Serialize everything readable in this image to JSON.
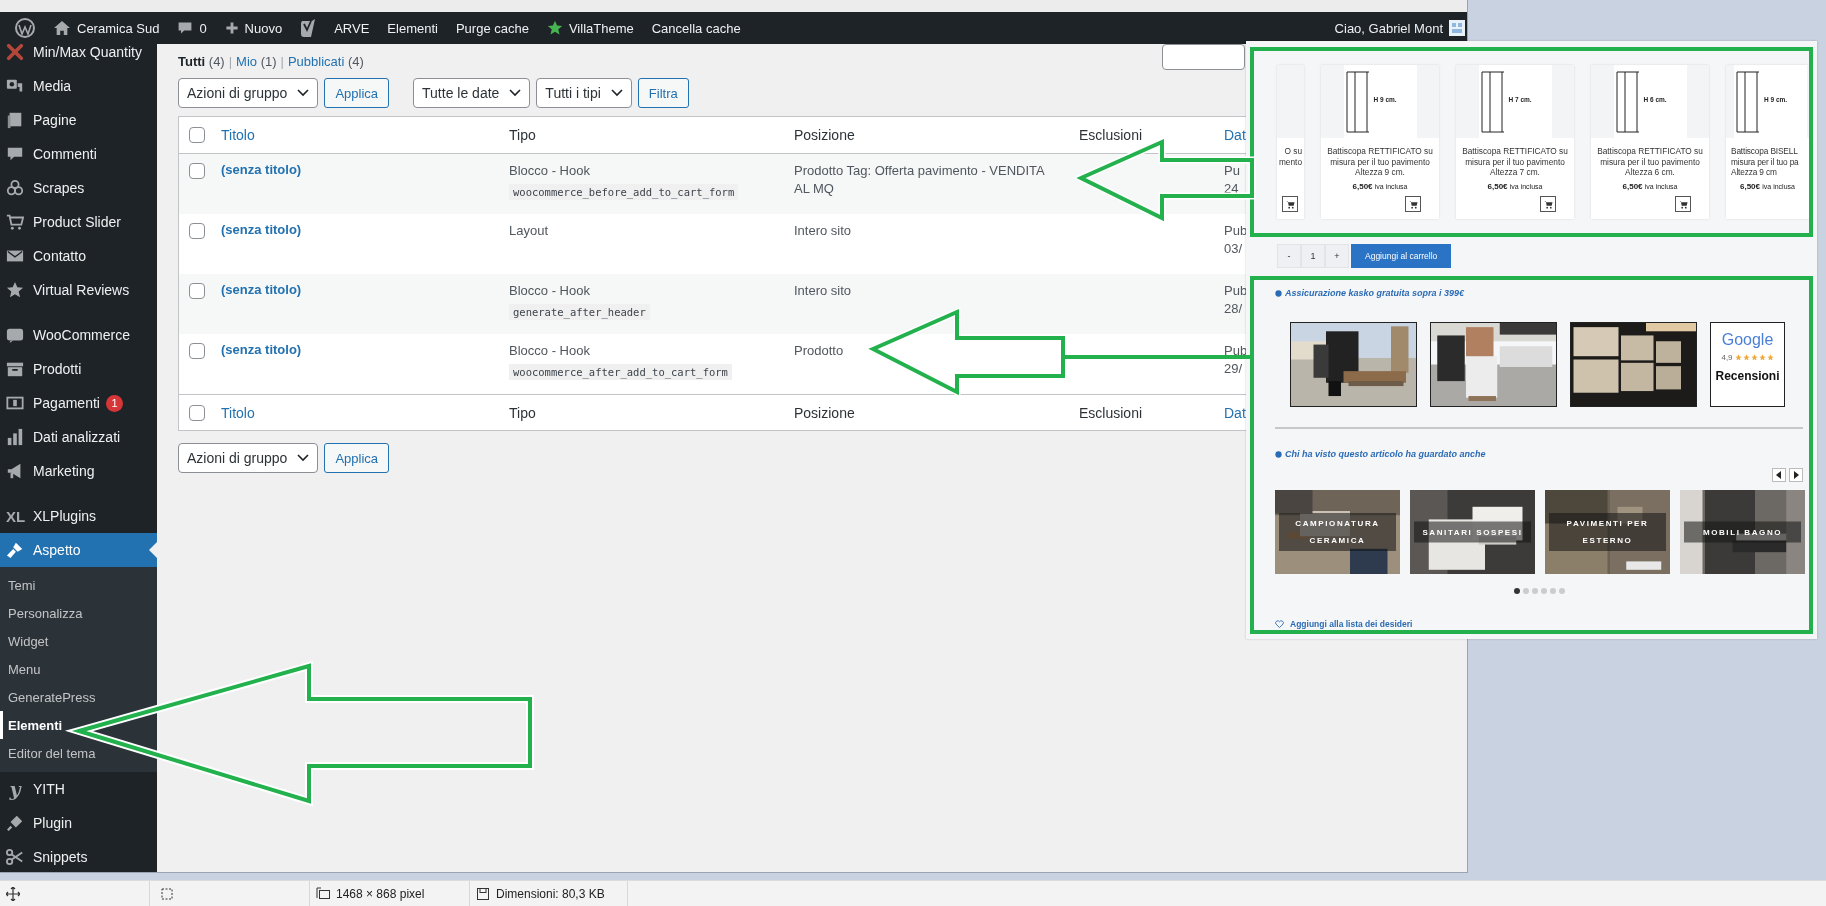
{
  "admin_bar": {
    "items": [
      {
        "kind": "wp"
      },
      {
        "kind": "home",
        "label": "Ceramica Sud"
      },
      {
        "kind": "comments",
        "label": "0"
      },
      {
        "kind": "new",
        "label": "Nuovo"
      },
      {
        "kind": "yoast"
      },
      {
        "kind": "text",
        "label": "ARVE"
      },
      {
        "kind": "text",
        "label": "Elementi"
      },
      {
        "kind": "text",
        "label": "Purge cache"
      },
      {
        "kind": "star",
        "label": "VillaTheme"
      },
      {
        "kind": "text",
        "label": "Cancella cache"
      }
    ],
    "greeting": "Ciao, Gabriel Mont"
  },
  "sidebar": {
    "groups": [
      {
        "items": [
          {
            "label": "Min/Max Quantity",
            "selected": false
          },
          {
            "label": "Media",
            "selected": false
          },
          {
            "label": "Pagine",
            "selected": false
          },
          {
            "label": "Commenti",
            "selected": false
          },
          {
            "label": "Scrapes",
            "selected": false
          },
          {
            "label": "Product Slider",
            "selected": false
          },
          {
            "label": "Contatto",
            "selected": false
          },
          {
            "label": "Virtual Reviews",
            "selected": false
          }
        ]
      },
      {
        "items": [
          {
            "label": "WooCommerce",
            "selected": false
          },
          {
            "label": "Prodotti",
            "selected": false
          },
          {
            "label": "Pagamenti",
            "selected": false,
            "badge": "1"
          },
          {
            "label": "Dati analizzati",
            "selected": false
          },
          {
            "label": "Marketing",
            "selected": false
          }
        ]
      },
      {
        "items": [
          {
            "label": "XLPlugins",
            "selected": false,
            "logo": "XL"
          },
          {
            "label": "Aspetto",
            "selected": true,
            "children": [
              {
                "label": "Temi",
                "selected": false
              },
              {
                "label": "Personalizza",
                "selected": false
              },
              {
                "label": "Widget",
                "selected": false
              },
              {
                "label": "Menu",
                "selected": false
              },
              {
                "label": "GeneratePress",
                "selected": false
              },
              {
                "label": "Elementi",
                "selected": true
              },
              {
                "label": "Editor del tema",
                "selected": false
              }
            ]
          },
          {
            "label": "YITH",
            "selected": false,
            "logo": "y"
          },
          {
            "label": "Plugin",
            "selected": false
          },
          {
            "label": "Snippets",
            "selected": false
          }
        ]
      }
    ]
  },
  "views": [
    {
      "label": "Tutti",
      "count": "(4)",
      "selected": true
    },
    {
      "label": "Mio",
      "count": "(1)",
      "selected": false
    },
    {
      "label": "Pubblicati",
      "count": "(4)",
      "selected": false
    }
  ],
  "views_separator": "|",
  "filters": {
    "bulk": "Azioni di gruppo",
    "apply": "Applica",
    "dates": "Tutte le date",
    "types": "Tutti i tipi",
    "filter": "Filtra"
  },
  "table": {
    "columns": [
      {
        "label": "Titolo",
        "sortable": true
      },
      {
        "label": "Tipo",
        "sortable": false
      },
      {
        "label": "Posizione",
        "sortable": false
      },
      {
        "label": "Esclusioni",
        "sortable": false
      },
      {
        "label": "Dat",
        "sortable": true
      }
    ],
    "header_checked": false,
    "rows": [
      {
        "checked": false,
        "title": "(senza titolo)",
        "type": "Blocco - Hook",
        "hook": "woocommerce_before_add_to_cart_form",
        "position": "Prodotto Tag: Offerta pavimento - VENDITA AL MQ",
        "date_lines": [
          "Pu",
          "24"
        ]
      },
      {
        "checked": false,
        "title": "(senza titolo)",
        "type": "Layout",
        "position": "Intero sito",
        "date_lines": [
          "Pub",
          "03/"
        ]
      },
      {
        "checked": false,
        "title": "(senza titolo)",
        "type": "Blocco - Hook",
        "hook": "generate_after_header",
        "position": "Intero sito",
        "date_lines": [
          "Pub",
          "28/"
        ]
      },
      {
        "checked": false,
        "title": "(senza titolo)",
        "type": "Blocco - Hook",
        "hook": "woocommerce_after_add_to_cart_form",
        "position": "Prodotto",
        "date_lines": [
          "Pub",
          "29/"
        ]
      }
    ],
    "footer_checked": false,
    "footer_columns": [
      {
        "label": "Titolo",
        "sortable": true
      },
      {
        "label": "Tipo",
        "sortable": false
      },
      {
        "label": "Posizione",
        "sortable": false
      },
      {
        "label": "Esclusioni",
        "sortable": false
      },
      {
        "label": "Dat",
        "sortable": true
      }
    ]
  },
  "bottom_actions": {
    "bulk": "Azioni di gruppo",
    "apply": "Applica"
  },
  "overlay": {
    "products": [
      {
        "title_lines": [
          "O su",
          "mento"
        ]
      },
      {
        "image_label": "H 9 cm.",
        "title_lines": [
          "Battiscopa RETTIFICATO su",
          "misura per il tuo pavimento",
          "Altezza 9 cm."
        ],
        "price": "6,50€",
        "price_note": "iva inclusa"
      },
      {
        "image_label": "H 7 cm.",
        "title_lines": [
          "Battiscopa RETTIFICATO su",
          "misura per il tuo pavimento",
          "Altezza 7 cm."
        ],
        "price": "6,50€",
        "price_note": "iva inclusa"
      },
      {
        "image_label": "H 6 cm.",
        "title_lines": [
          "Battiscopa RETTIFICATO su",
          "misura per il tuo pavimento",
          "Altezza 6 cm."
        ],
        "price": "6,50€",
        "price_note": "iva inclusa"
      },
      {
        "image_label": "H 9 cm.",
        "title_lines": [
          "Battiscopa BISELL",
          "misura per il tuo pa",
          "Altezza 9 cm"
        ],
        "price": "6,50€",
        "price_note": "iva inclusa"
      }
    ],
    "quantity": {
      "minus": "-",
      "value": "1",
      "plus": "+"
    },
    "add_to_cart": "Aggiungi al carrello",
    "insurance": "Assicurazione kasko gratuita sopra i 399€",
    "review_badge": {
      "brand": "Google",
      "rating": "4,9",
      "stars": 5,
      "label": "Recensioni"
    },
    "related_heading": "Chi ha visto questo articolo ha guardato anche",
    "categories": [
      {
        "caption": "CAMPIONATURA CERAMICA"
      },
      {
        "caption": "SANITARI SOSPESI"
      },
      {
        "caption": "PAVIMENTI PER ESTERNO"
      },
      {
        "caption": "MOBILI BAGNO"
      }
    ],
    "dots": [
      {
        "selected": true
      },
      {
        "selected": false
      },
      {
        "selected": false
      },
      {
        "selected": false
      },
      {
        "selected": false
      },
      {
        "selected": false
      }
    ],
    "wishlist": "Aggiungi alla lista dei desideri"
  },
  "status_bar": {
    "dimensions": "1468 × 868 pixel",
    "size": "Dimensioni: 80,3 KB"
  }
}
